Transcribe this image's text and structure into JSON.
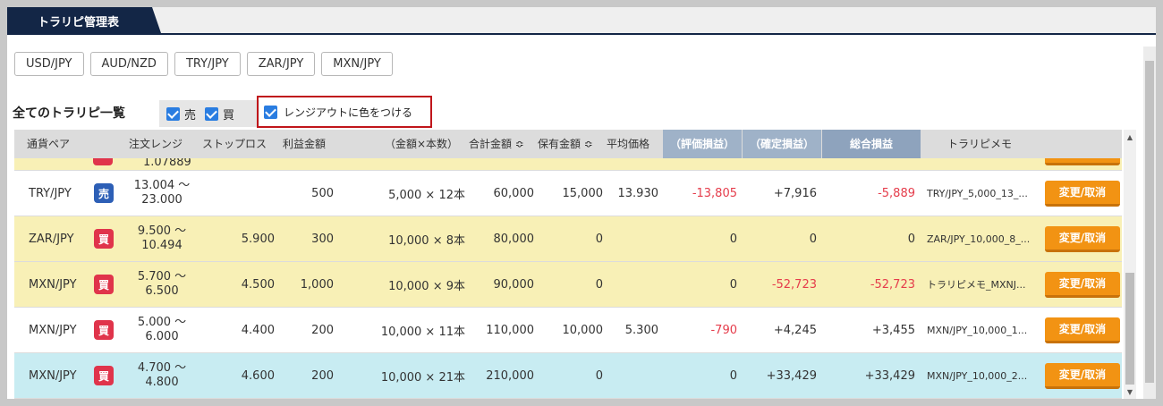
{
  "tab": {
    "title": "トラリピ管理表"
  },
  "pairs": [
    "USD/JPY",
    "AUD/NZD",
    "TRY/JPY",
    "ZAR/JPY",
    "MXN/JPY"
  ],
  "list": {
    "title": "全てのトラリピ一覧",
    "filter_sell": "売",
    "filter_buy": "買",
    "range_out_label": "レンジアウトに色をつける"
  },
  "columns": {
    "pair": "通貨ペア",
    "order_range": "注文レンジ",
    "stop_loss": "ストップロス",
    "take_profit": "利益金額",
    "amount_count": "（金額×本数）",
    "total_amount": "合計金額 ≎",
    "holding": "保有金額 ≎",
    "avg_price": "平均価格",
    "unrealized": "（評価損益）",
    "realized": "（確定損益）",
    "total_pl": "総合損益",
    "memo": "トラリピメモ"
  },
  "partial_row": {
    "range_bottom": "1.07889"
  },
  "rows": [
    {
      "pair": "TRY/JPY",
      "side": "売",
      "range_top": "13.004 〜",
      "range_bottom": "23.000",
      "stop": "",
      "profit": "500",
      "amount": "5,000 × 12本",
      "total": "60,000",
      "holding": "15,000",
      "avg": "13.930",
      "unrealized": "-13,805",
      "realized": "+7,916",
      "total_pl": "-5,889",
      "memo": "TRY/JPY_5,000_13_...",
      "action": "変更/取消"
    },
    {
      "pair": "ZAR/JPY",
      "side": "買",
      "range_top": "9.500 〜",
      "range_bottom": "10.494",
      "stop": "5.900",
      "profit": "300",
      "amount": "10,000 × 8本",
      "total": "80,000",
      "holding": "0",
      "avg": "",
      "unrealized": "0",
      "realized": "0",
      "total_pl": "0",
      "memo": "ZAR/JPY_10,000_8_...",
      "action": "変更/取消"
    },
    {
      "pair": "MXN/JPY",
      "side": "買",
      "range_top": "5.700 〜",
      "range_bottom": "6.500",
      "stop": "4.500",
      "profit": "1,000",
      "amount": "10,000 × 9本",
      "total": "90,000",
      "holding": "0",
      "avg": "",
      "unrealized": "0",
      "realized": "-52,723",
      "total_pl": "-52,723",
      "memo": "トラリピメモ_MXNJ...",
      "action": "変更/取消"
    },
    {
      "pair": "MXN/JPY",
      "side": "買",
      "range_top": "5.000 〜",
      "range_bottom": "6.000",
      "stop": "4.400",
      "profit": "200",
      "amount": "10,000 × 11本",
      "total": "110,000",
      "holding": "10,000",
      "avg": "5.300",
      "unrealized": "-790",
      "realized": "+4,245",
      "total_pl": "+3,455",
      "memo": "MXN/JPY_10,000_1...",
      "action": "変更/取消"
    },
    {
      "pair": "MXN/JPY",
      "side": "買",
      "range_top": "4.700 〜",
      "range_bottom": "4.800",
      "stop": "4.600",
      "profit": "200",
      "amount": "10,000 × 21本",
      "total": "210,000",
      "holding": "0",
      "avg": "",
      "unrealized": "0",
      "realized": "+33,429",
      "total_pl": "+33,429",
      "memo": "MXN/JPY_10,000_2...",
      "action": "変更/取消"
    }
  ],
  "colors": {
    "navy": "#132646",
    "sell": "#2d5fb6",
    "buy": "#e0344b",
    "orange": "#f29313",
    "negative": "#e53c4b"
  }
}
